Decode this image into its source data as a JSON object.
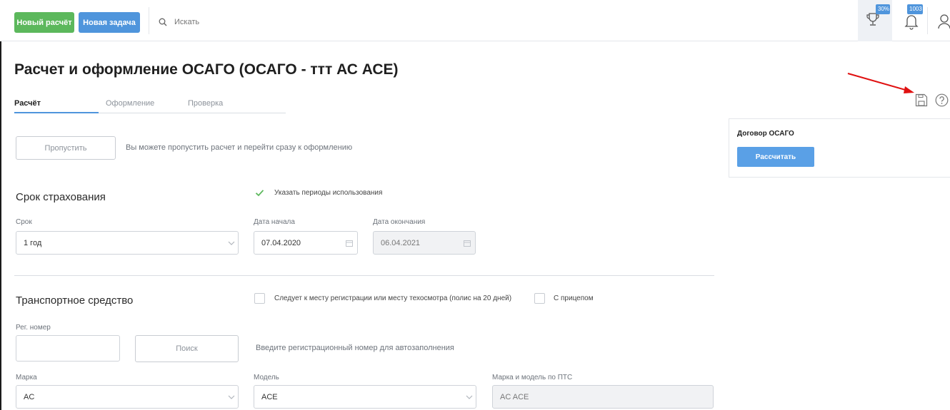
{
  "header": {
    "new_calc_label": "Новый расчёт",
    "new_task_label": "Новая задача",
    "search_placeholder": "Искать",
    "trophy_badge": "30%",
    "bell_badge": "1003"
  },
  "page": {
    "title": "Расчет и оформление ОСАГО (ОСАГО - ттт АС АСЕ)",
    "tabs": [
      {
        "label": "Расчёт",
        "active": true
      },
      {
        "label": "Оформление",
        "active": false
      },
      {
        "label": "Проверка",
        "active": false
      }
    ]
  },
  "skip": {
    "button_label": "Пропустить",
    "hint": "Вы можете пропустить расчет и перейти сразу к оформлению"
  },
  "insurance_term": {
    "section_title": "Срок страхования",
    "periods_checkbox_label": "Указать периоды использования",
    "periods_checked": true,
    "term_label": "Срок",
    "term_value": "1 год",
    "start_label": "Дата начала",
    "start_value": "07.04.2020",
    "end_label": "Дата окончания",
    "end_value": "06.04.2021"
  },
  "vehicle": {
    "section_title": "Транспортное средство",
    "follows_checkbox_label": "Следует к месту регистрации или месту техосмотра (полис на 20 дней)",
    "follows_checked": false,
    "trailer_checkbox_label": "С прицепом",
    "trailer_checked": false,
    "reg_label": "Рег. номер",
    "reg_value": "",
    "search_button_label": "Поиск",
    "search_hint": "Введите регистрационный номер для автозаполнения",
    "make_label": "Марка",
    "make_value": "AC",
    "model_label": "Модель",
    "model_value": "ACE",
    "pts_label": "Марка и модель по ПТС",
    "pts_value": "AC ACE"
  },
  "right_panel": {
    "title": "Договор ОСАГО",
    "calculate_label": "Рассчитать"
  },
  "colors": {
    "green": "#5cb85c",
    "blue": "#4f95dc",
    "arrow_red": "#e01010"
  }
}
